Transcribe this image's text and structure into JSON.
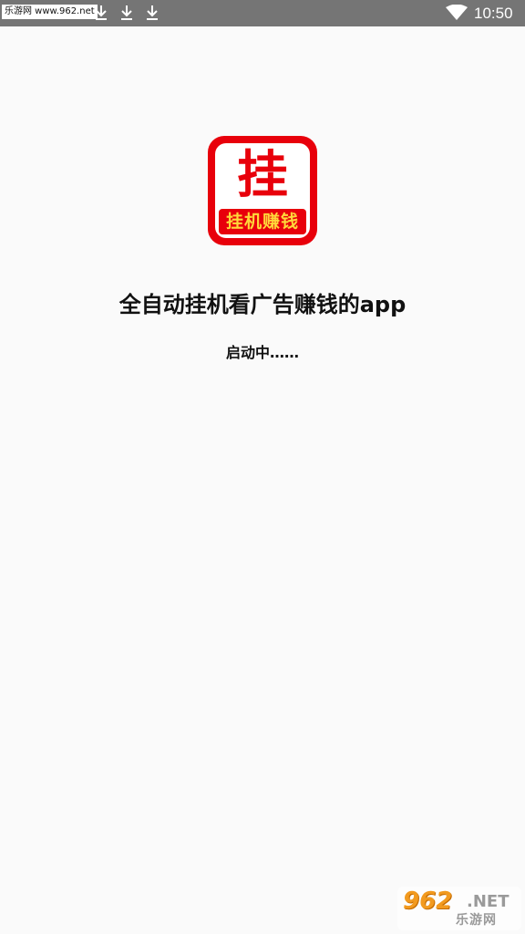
{
  "status_bar": {
    "watermark": "乐游网 www.962.net",
    "time": "10:50",
    "icons": [
      "download-icon",
      "download-icon",
      "download-icon",
      "wifi-icon"
    ],
    "color": "#757575"
  },
  "app": {
    "logo_char": "挂",
    "logo_banner": "挂机赚钱",
    "title": "全自动挂机看广告赚钱的app",
    "loading": "启动中……",
    "brand_color": "#e8000b",
    "banner_text_color": "#ffd83a"
  },
  "watermark": {
    "number": "962",
    "suffix": ".NET",
    "name": "乐游网"
  }
}
